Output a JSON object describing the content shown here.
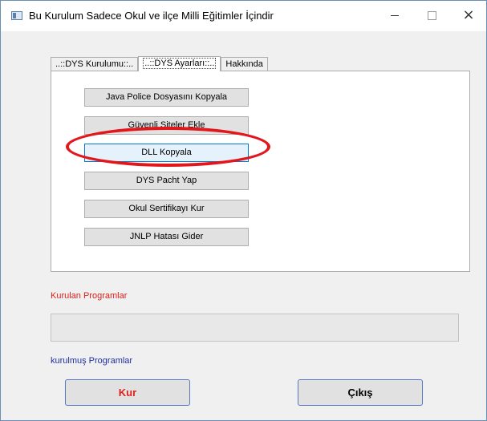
{
  "window": {
    "title": "Bu Kurulum Sadece Okul ve  ilçe Milli Eğitimler İçindir",
    "minimize_glyph": "",
    "maximize_glyph": "",
    "close_glyph": "×"
  },
  "tabs": [
    {
      "label": "..::DYS Kurulumu::..",
      "active": false
    },
    {
      "label": "..::DYS Ayarları::..",
      "active": true
    },
    {
      "label": "Hakkında",
      "active": false
    }
  ],
  "settings_buttons": [
    "Java Police Dosyasını Kopyala",
    "Güvenli Siteler Ekle",
    "DLL Kopyala",
    "DYS Pacht Yap",
    "Okul Sertifikayı Kur",
    "JNLP Hatası Gider"
  ],
  "labels": {
    "installed_programs": "Kurulan Programlar",
    "installed_programs_2": "kurulmuş Programlar"
  },
  "actions": {
    "install": "Kur",
    "exit": "Çıkış"
  },
  "annotation": {
    "highlight_color": "#e2161b",
    "highlighted_button": "DLL Kopyala"
  }
}
